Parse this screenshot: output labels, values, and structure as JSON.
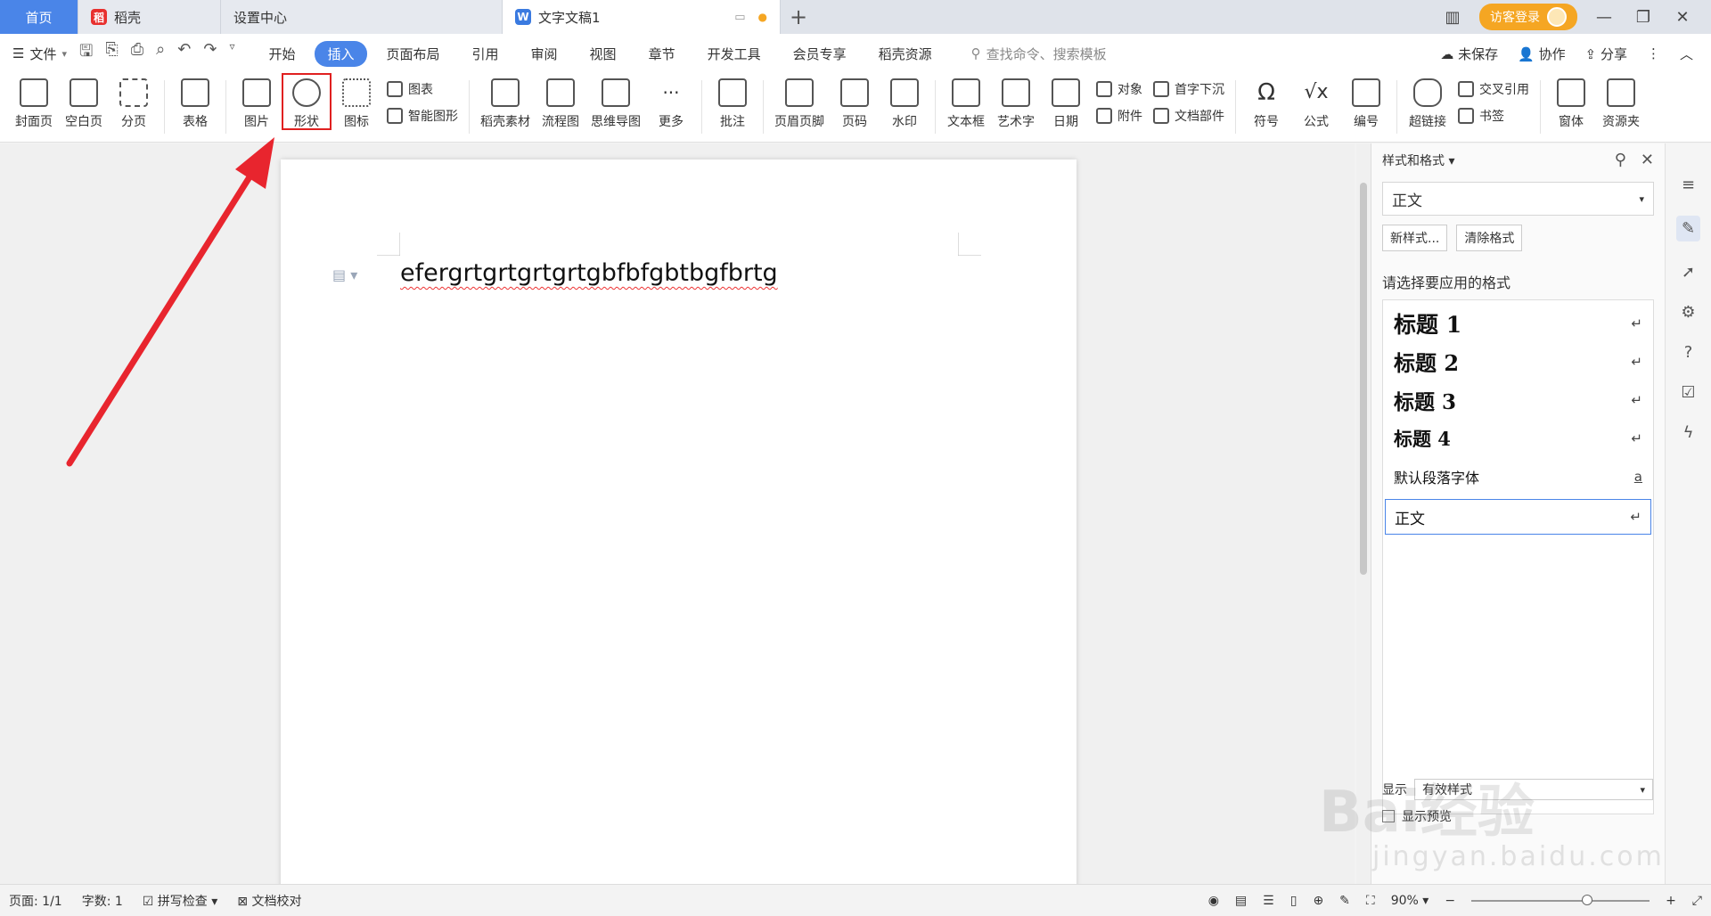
{
  "tabs": [
    {
      "label": "首页",
      "active": true
    },
    {
      "label": "稻壳"
    },
    {
      "label": "设置中心"
    },
    {
      "label": "文字文稿1",
      "current": true
    }
  ],
  "tabbar_right": {
    "visitor_login": "访客登录"
  },
  "menu": {
    "file": "文件",
    "tabs": [
      "开始",
      "插入",
      "页面布局",
      "引用",
      "审阅",
      "视图",
      "章节",
      "开发工具",
      "会员专享",
      "稻壳资源"
    ],
    "active_tab": "插入",
    "search_placeholder": "查找命令、搜索模板",
    "right": [
      "未保存",
      "协作",
      "分享"
    ]
  },
  "ribbon": {
    "cover_page": "封面页",
    "blank_page": "空白页",
    "page_break": "分页",
    "table": "表格",
    "picture": "图片",
    "shape": "形状",
    "icon": "图标",
    "chart": "图表",
    "smart_shape": "智能图形",
    "daoke_material": "稻壳素材",
    "flowchart": "流程图",
    "mind_map": "思维导图",
    "more": "更多",
    "comment": "批注",
    "header_footer": "页眉页脚",
    "page_number": "页码",
    "watermark": "水印",
    "text_box": "文本框",
    "word_art": "艺术字",
    "date": "日期",
    "object": "对象",
    "attachment": "附件",
    "drop_cap": "首字下沉",
    "doc_parts": "文档部件",
    "symbol": "符号",
    "formula": "公式",
    "numbering": "编号",
    "hyperlink": "超链接",
    "cross_reference": "交叉引用",
    "bookmark": "书签",
    "window": "窗体",
    "resource_folder": "资源夹"
  },
  "document": {
    "text": "efergrtgrtgrtgrtgbfbfgbtbgfbrtg"
  },
  "styles_panel": {
    "title": "样式和格式",
    "current_style": "正文",
    "new_style": "新样式...",
    "clear_format": "清除格式",
    "subtitle": "请选择要应用的格式",
    "styles": [
      {
        "name": "标题 1",
        "mark": "↵"
      },
      {
        "name": "标题 2",
        "mark": "↵"
      },
      {
        "name": "标题 3",
        "mark": "↵"
      },
      {
        "name": "标题 4",
        "mark": "↵"
      },
      {
        "name": "默认段落字体",
        "mark": "a"
      },
      {
        "name": "正文",
        "mark": "↵"
      }
    ],
    "show_label": "显示",
    "show_value": "有效样式",
    "show_preview": "显示预览"
  },
  "status": {
    "page": "页面: 1/1",
    "word_count": "字数: 1",
    "spell_check": "拼写检查",
    "doc_proof": "文档校对",
    "zoom": "90%"
  },
  "watermark_text": {
    "brand": "Bai经验",
    "url": "jingyan.baidu.com"
  },
  "colors": {
    "accent": "#4a85e8",
    "highlight": "#e02020",
    "arrow": "#e8252e",
    "visitor": "#f5a623"
  }
}
